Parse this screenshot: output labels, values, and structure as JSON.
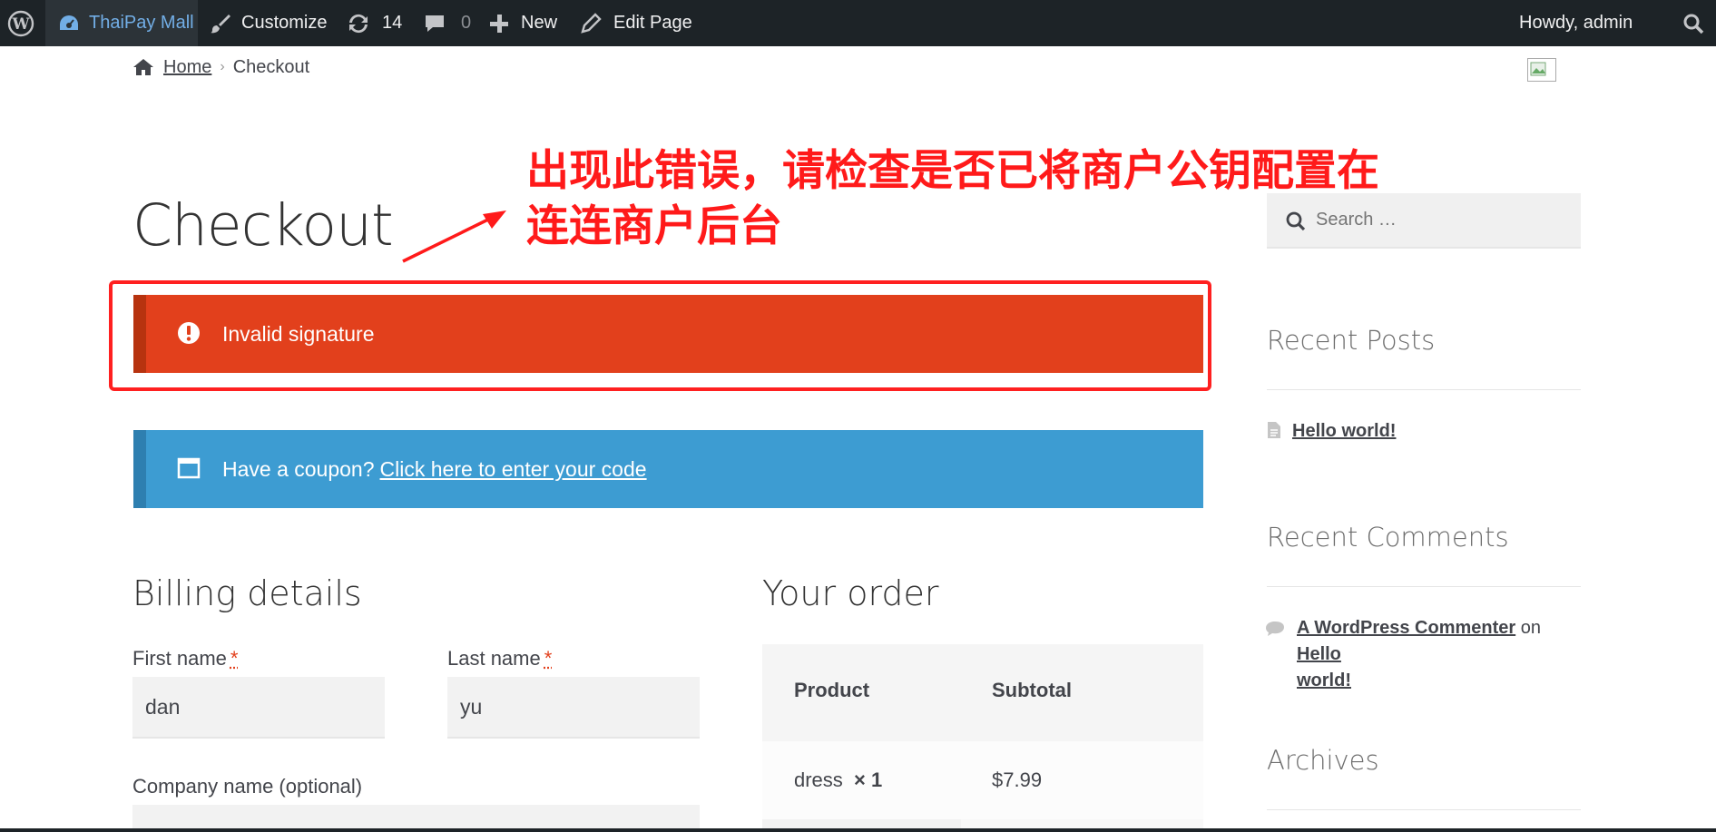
{
  "adminbar": {
    "site_name": "ThaiPay Mall",
    "customize": "Customize",
    "updates_count": "14",
    "comments_count": "0",
    "new": "New",
    "edit_page": "Edit Page",
    "howdy": "Howdy, admin"
  },
  "breadcrumb": {
    "home": "Home",
    "current": "Checkout"
  },
  "page": {
    "title": "Checkout"
  },
  "annotation": {
    "line1": "出现此错误，请检查是否已将商户公钥配置在",
    "line2": "连连商户后台"
  },
  "notices": {
    "error": "Invalid signature",
    "coupon_prefix": "Have a coupon?",
    "coupon_link": "Click here to enter your code"
  },
  "billing": {
    "title": "Billing details",
    "first_name_label": "First name",
    "last_name_label": "Last name",
    "required_mark": "*",
    "first_name": "dan",
    "last_name": "yu",
    "company_label": "Company name (optional)"
  },
  "order": {
    "title": "Your order",
    "col_product": "Product",
    "col_subtotal": "Subtotal",
    "item_name": "dress",
    "item_qty": "× 1",
    "item_subtotal": "$7.99"
  },
  "sidebar": {
    "search_placeholder": "Search …",
    "recent_posts_title": "Recent Posts",
    "post_1": "Hello world!",
    "recent_comments_title": "Recent Comments",
    "comment_author": "A WordPress Commenter",
    "comment_on": "on",
    "comment_post_line1": "Hello",
    "comment_post_line2": "world!",
    "archives_title": "Archives"
  },
  "colors": {
    "adminbar_bg": "#1d2327",
    "error_bg": "#e2401c",
    "info_bg": "#3d9cd2",
    "annotation_red": "#ff1a1a"
  }
}
